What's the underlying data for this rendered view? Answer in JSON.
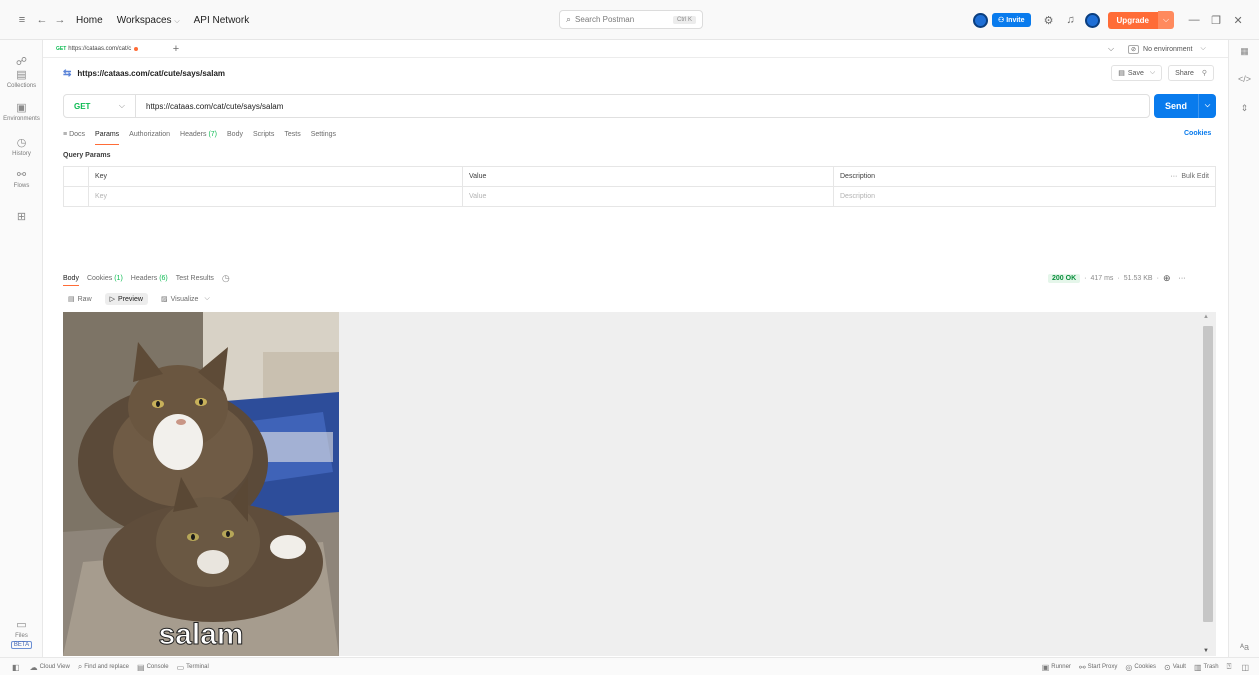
{
  "topbar": {
    "nav": [
      "Home",
      "Workspaces",
      "API Network"
    ],
    "search_placeholder": "Search Postman",
    "search_shortcut": "Ctrl K",
    "invite_label": "Invite",
    "upgrade_label": "Upgrade"
  },
  "sidebar": {
    "items": [
      {
        "icon": "people-icon",
        "label": ""
      },
      {
        "icon": "collections-icon",
        "label": "Collections"
      },
      {
        "icon": "environments-icon",
        "label": "Environments"
      },
      {
        "icon": "history-icon",
        "label": "History"
      },
      {
        "icon": "flows-icon",
        "label": "Flows"
      },
      {
        "icon": "apps-icon",
        "label": ""
      }
    ],
    "files_label": "Files",
    "beta_label": "BETA"
  },
  "tab": {
    "method": "GET",
    "title": "https://cataas.com/cat/c"
  },
  "environment": {
    "label": "No environment"
  },
  "request": {
    "title": "https://cataas.com/cat/cute/says/salam",
    "method": "GET",
    "url": "https://cataas.com/cat/cute/says/salam",
    "save_label": "Save",
    "share_label": "Share",
    "send_label": "Send"
  },
  "request_tabs": [
    {
      "label": "Docs",
      "count": ""
    },
    {
      "label": "Params",
      "count": "",
      "active": true
    },
    {
      "label": "Authorization",
      "count": ""
    },
    {
      "label": "Headers",
      "count": "(7)"
    },
    {
      "label": "Body",
      "count": ""
    },
    {
      "label": "Scripts",
      "count": ""
    },
    {
      "label": "Tests",
      "count": ""
    },
    {
      "label": "Settings",
      "count": ""
    }
  ],
  "cookies_link": "Cookies",
  "query_params": {
    "title": "Query Params",
    "columns": [
      "Key",
      "Value",
      "Description"
    ],
    "bulk_edit": "Bulk Edit",
    "placeholders": [
      "Key",
      "Value",
      "Description"
    ]
  },
  "response": {
    "tabs": [
      {
        "label": "Body",
        "count": "",
        "active": true
      },
      {
        "label": "Cookies",
        "count": "(1)"
      },
      {
        "label": "Headers",
        "count": "(6)"
      },
      {
        "label": "Test Results",
        "count": ""
      }
    ],
    "status": "200 OK",
    "time": "417 ms",
    "size": "51.53 KB",
    "views": [
      "Raw",
      "Preview",
      "Visualize"
    ],
    "image_caption": "salam"
  },
  "bottombar": {
    "left": [
      "Cloud View",
      "Find and replace",
      "Console",
      "Terminal"
    ],
    "right": [
      "Runner",
      "Start Proxy",
      "Cookies",
      "Vault",
      "Trash"
    ]
  }
}
